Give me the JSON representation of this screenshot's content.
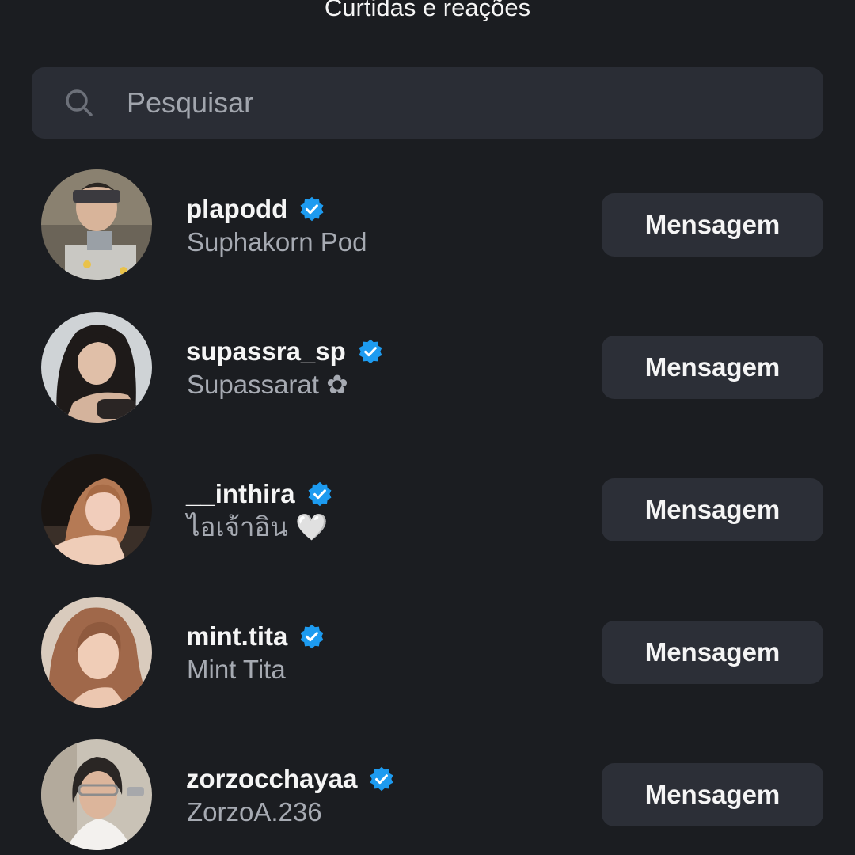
{
  "header": {
    "title": "Curtidas e reações"
  },
  "search": {
    "placeholder": "Pesquisar",
    "value": ""
  },
  "users": [
    {
      "username": "plapodd",
      "full_name": "Suphakorn Pod",
      "verified": true,
      "button_label": "Mensagem"
    },
    {
      "username": "supassra_sp",
      "full_name": "Supassarat ✿",
      "verified": true,
      "button_label": "Mensagem"
    },
    {
      "username": "__inthira",
      "full_name": "ไอเจ้าอิน 🤍",
      "verified": true,
      "button_label": "Mensagem"
    },
    {
      "username": "mint.tita",
      "full_name": "Mint Tita",
      "verified": true,
      "button_label": "Mensagem"
    },
    {
      "username": "zorzocchayaa",
      "full_name": "ZorzoA.236",
      "verified": true,
      "button_label": "Mensagem"
    }
  ],
  "colors": {
    "background": "#1b1d21",
    "search_bg": "#2a2d35",
    "button_bg": "#2c2f37",
    "verified_badge": "#1d9bf0",
    "secondary_text": "#a6aab2"
  },
  "icons": {
    "search": "search-icon",
    "verified": "verified-badge-icon"
  }
}
